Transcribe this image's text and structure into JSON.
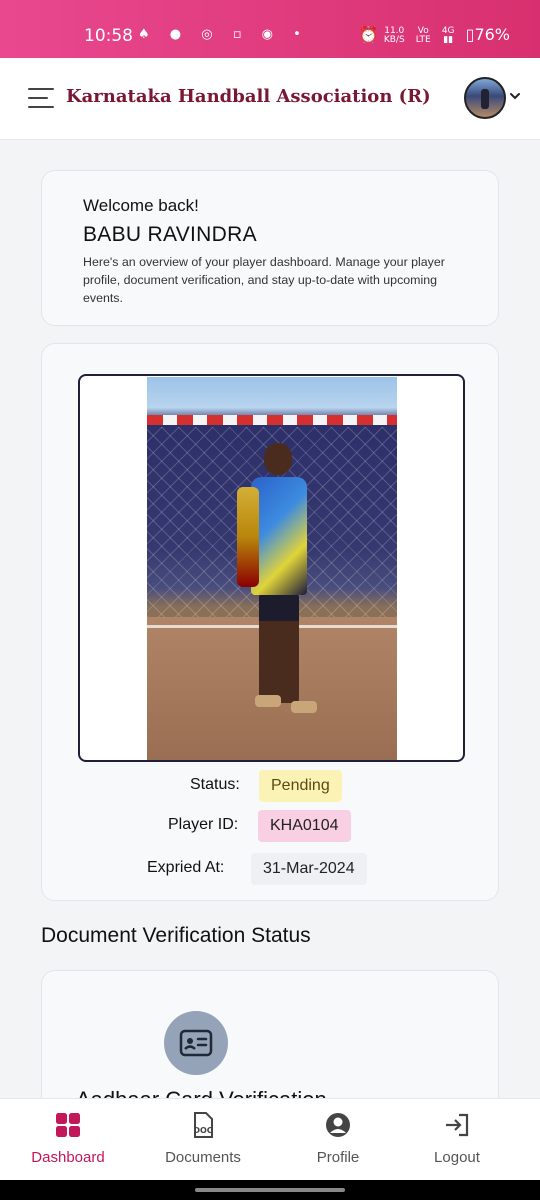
{
  "status_bar": {
    "time": "10:58",
    "left_icons": "♠ ● ◎ ▫ ◉ •",
    "network_speed_top": "11.0",
    "network_speed_unit": "KB/S",
    "volte_top": "Vo",
    "volte_bottom": "LTE",
    "network_type": "4G",
    "battery": "76%"
  },
  "header": {
    "title": "Karnataka Handball Association (R)",
    "menu_icon": "hamburger-icon",
    "avatar_icon": "avatar",
    "dropdown_icon": "chevron-down-icon"
  },
  "welcome": {
    "greeting": "Welcome back!",
    "name": "BABU RAVINDRA",
    "description": "Here's an overview of your player dashboard. Manage your player profile, document verification, and stay up-to-date with upcoming events."
  },
  "player": {
    "status_label": "Status:",
    "status_value": "Pending",
    "id_label": "Player ID:",
    "id_value": "KHA0104",
    "expiry_label": "Expried At:",
    "expiry_value": "31-Mar-2024"
  },
  "documents": {
    "section_title": "Document Verification Status",
    "card_title": "Aadhaar Card Verification",
    "card_icon": "id-card-icon"
  },
  "bottom_nav": {
    "items": [
      {
        "label": "Dashboard",
        "icon": "grid-icon",
        "active": true
      },
      {
        "label": "Documents",
        "icon": "doc-file-icon",
        "active": false
      },
      {
        "label": "Profile",
        "icon": "user-circle-icon",
        "active": false
      },
      {
        "label": "Logout",
        "icon": "logout-icon",
        "active": false
      }
    ]
  },
  "colors": {
    "accent": "#c2185b",
    "brand_text": "#7a1734",
    "status_bar": "#e0407f",
    "pending_bg": "#fbf3b5",
    "player_id_bg": "#f8cfe3"
  }
}
